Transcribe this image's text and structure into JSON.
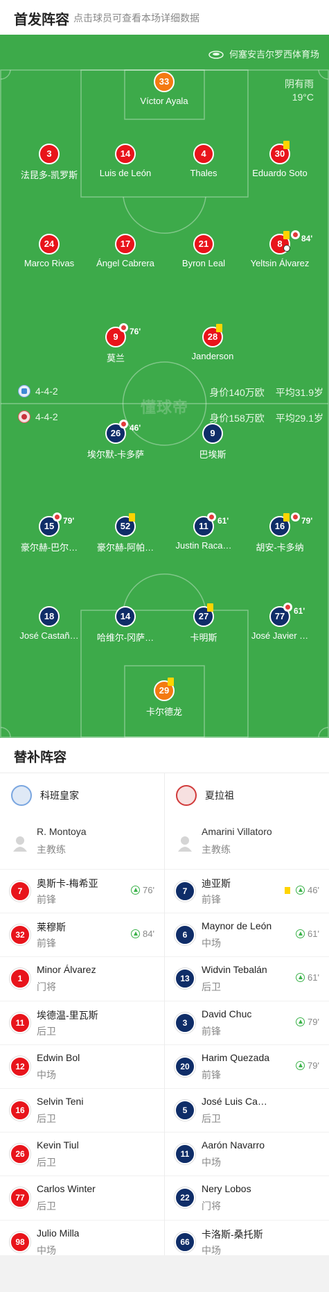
{
  "header": {
    "title": "首发阵容",
    "subtitle": "点击球员可查看本场详细数据"
  },
  "pitch": {
    "venue": "何塞安吉尔罗西体育场",
    "weather": "阴有雨",
    "temperature": "19°C",
    "watermark": "懂球帝",
    "home": {
      "formation": "4-4-2",
      "value": "身价140万欧",
      "age": "平均31.9岁"
    },
    "away": {
      "formation": "4-4-2",
      "value": "身价158万欧",
      "age": "平均29.1岁"
    }
  },
  "home_players": [
    {
      "number": "33",
      "name": "Víctor Ayala",
      "kit": "gk"
    },
    {
      "number": "3",
      "name": "法昆多-凯罗斯",
      "kit": "red"
    },
    {
      "number": "14",
      "name": "Luis de León",
      "kit": "red"
    },
    {
      "number": "4",
      "name": "Thales",
      "kit": "red"
    },
    {
      "number": "30",
      "name": "Eduardo Soto",
      "kit": "red",
      "yellow": true
    },
    {
      "number": "24",
      "name": "Marco Rivas",
      "kit": "red"
    },
    {
      "number": "17",
      "name": "Ángel Cabrera",
      "kit": "red"
    },
    {
      "number": "21",
      "name": "Byron Leal",
      "kit": "red"
    },
    {
      "number": "8",
      "name": "Yeltsin Álvarez",
      "kit": "red",
      "yellow": true,
      "sub_off": "84'",
      "goal": true
    },
    {
      "number": "9",
      "name": "莫兰",
      "kit": "red",
      "sub_off": "76'"
    },
    {
      "number": "28",
      "name": "Janderson",
      "kit": "red",
      "yellow": true
    }
  ],
  "away_players": [
    {
      "number": "26",
      "name": "埃尔默-卡多萨",
      "kit": "navy",
      "sub_off": "46'"
    },
    {
      "number": "9",
      "name": "巴埃斯",
      "kit": "navy"
    },
    {
      "number": "15",
      "name": "豪尔赫-巴尔…",
      "kit": "navy",
      "sub_off": "79'"
    },
    {
      "number": "52",
      "name": "豪尔赫-阿帕…",
      "kit": "navy",
      "yellow": true
    },
    {
      "number": "11",
      "name": "Justin Raca…",
      "kit": "navy",
      "sub_off": "61'"
    },
    {
      "number": "16",
      "name": "胡安-卡多纳",
      "kit": "navy",
      "yellow": true,
      "sub_off": "79'"
    },
    {
      "number": "18",
      "name": "José Castañ…",
      "kit": "navy"
    },
    {
      "number": "14",
      "name": "哈维尔-冈萨…",
      "kit": "navy"
    },
    {
      "number": "27",
      "name": "卡明斯",
      "kit": "navy",
      "yellow": true
    },
    {
      "number": "77",
      "name": "José Javier …",
      "kit": "navy",
      "sub_off": "61'"
    },
    {
      "number": "29",
      "name": "卡尔德龙",
      "kit": "gk",
      "yellow": true
    }
  ],
  "bench": {
    "title": "替补阵容",
    "home": {
      "team": "科班皇家",
      "coach": {
        "name": "R. Montoya",
        "role": "主教练"
      },
      "players": [
        {
          "number": "7",
          "name": "奥斯卡-梅希亚",
          "position": "前锋",
          "sub_on": "76'"
        },
        {
          "number": "32",
          "name": "莱穆斯",
          "position": "前锋",
          "sub_on": "84'"
        },
        {
          "number": "1",
          "name": "Minor Álvarez",
          "position": "门将"
        },
        {
          "number": "11",
          "name": "埃德温-里瓦斯",
          "position": "后卫"
        },
        {
          "number": "12",
          "name": "Edwin Bol",
          "position": "中场"
        },
        {
          "number": "16",
          "name": "Selvin Teni",
          "position": "后卫"
        },
        {
          "number": "26",
          "name": "Kevin Tiul",
          "position": "后卫"
        },
        {
          "number": "77",
          "name": "Carlos Winter",
          "position": "后卫"
        },
        {
          "number": "98",
          "name": "Julio Milla",
          "position": "中场"
        }
      ]
    },
    "away": {
      "team": "夏拉祖",
      "coach": {
        "name": "Amarini Villatoro",
        "role": "主教练"
      },
      "players": [
        {
          "number": "7",
          "name": "迪亚斯",
          "position": "前锋",
          "sub_on": "46'",
          "yellow": true
        },
        {
          "number": "6",
          "name": "Maynor de León",
          "position": "中场",
          "sub_on": "61'"
        },
        {
          "number": "13",
          "name": "Widvin Tebalán",
          "position": "后卫",
          "sub_on": "61'"
        },
        {
          "number": "3",
          "name": "David Chuc",
          "position": "前锋",
          "sub_on": "79'"
        },
        {
          "number": "20",
          "name": "Harim Quezada",
          "position": "前锋",
          "sub_on": "79'"
        },
        {
          "number": "5",
          "name": "José Luis Ca…",
          "position": "后卫"
        },
        {
          "number": "11",
          "name": "Aarón Navarro",
          "position": "中场"
        },
        {
          "number": "22",
          "name": "Nery Lobos",
          "position": "门将"
        },
        {
          "number": "66",
          "name": "卡洛斯-桑托斯",
          "position": "中场"
        }
      ]
    }
  }
}
